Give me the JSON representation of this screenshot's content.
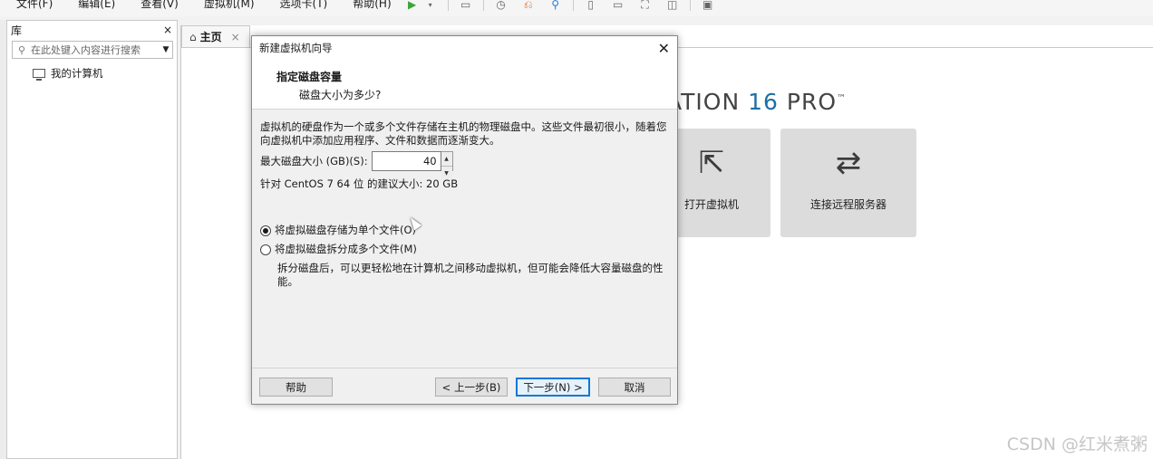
{
  "menubar": {
    "items": [
      "文件(F)",
      "编辑(E)",
      "查看(V)",
      "虚拟机(M)",
      "选项卡(T)",
      "帮助(H)"
    ],
    "toolbar_icons": [
      "play-icon",
      "dropdown-icon",
      "send-keys-icon",
      "snapshot-icon",
      "revert-snapshot-icon",
      "manage-snapshots-icon",
      "library-view-icon",
      "thumbnail-view-icon",
      "fullscreen-icon",
      "unity-icon",
      "console-icon"
    ]
  },
  "library": {
    "title": "库",
    "close": "×",
    "search_placeholder": "在此处键入内容进行搜索",
    "tree_item": "我的计算机"
  },
  "main": {
    "tab_label": "主页",
    "tab_close": "×",
    "brand_text": "ATION ",
    "brand_version": "16",
    "brand_suffix": " PRO",
    "brand_tm": "™",
    "card_open_label": "打开虚拟机",
    "card_remote_label": "连接远程服务器"
  },
  "dialog": {
    "title": "新建虚拟机向导",
    "close": "✕",
    "header_title": "指定磁盘容量",
    "header_subtitle": "磁盘大小为多少?",
    "description": "虚拟机的硬盘作为一个或多个文件存储在主机的物理磁盘中。这些文件最初很小，随着您向虚拟机中添加应用程序、文件和数据而逐渐变大。",
    "size_label": "最大磁盘大小 (GB)(S):",
    "size_value": "40",
    "recommend_text": "针对 CentOS 7 64 位 的建议大小: 20 GB",
    "radio_single": "将虚拟磁盘存储为单个文件(O)",
    "radio_single_selected": true,
    "radio_split": "将虚拟磁盘拆分成多个文件(M)",
    "split_desc": "拆分磁盘后，可以更轻松地在计算机之间移动虚拟机，但可能会降低大容量磁盘的性能。",
    "btn_help": "帮助",
    "btn_back": "< 上一步(B)",
    "btn_next": "下一步(N) >",
    "btn_cancel": "取消"
  },
  "watermark": "CSDN @红米煮粥"
}
